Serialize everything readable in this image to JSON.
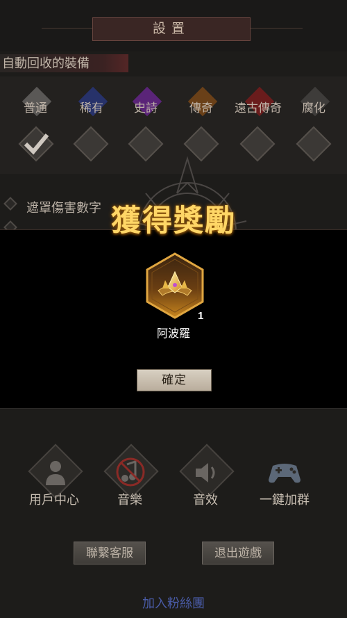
{
  "settings": {
    "title": "設置",
    "auto_recycle_header": "自動回收的裝備",
    "rarities": [
      {
        "label": "普通",
        "color": "#6b6a68"
      },
      {
        "label": "稀有",
        "color": "#2a3a7a"
      },
      {
        "label": "史詩",
        "color": "#6a2a8a"
      },
      {
        "label": "傳奇",
        "color": "#7a4a1a"
      },
      {
        "label": "遠古傳奇",
        "color": "#7a1a1a"
      },
      {
        "label": "腐化",
        "color": "#4a4846"
      }
    ],
    "checks": [
      true,
      false,
      false,
      false,
      false,
      false
    ],
    "options": [
      {
        "label": "遮罩傷害數字"
      },
      {
        "label": ""
      }
    ]
  },
  "reward": {
    "title": "獲得獎勵",
    "item_name": "阿波羅",
    "item_qty": "1",
    "item_icon": "crown-icon",
    "confirm_label": "確定"
  },
  "menu": {
    "items": [
      {
        "label": "用戶中心",
        "icon": "user-icon"
      },
      {
        "label": "音樂",
        "icon": "music-muted-icon"
      },
      {
        "label": "音效",
        "icon": "speaker-icon"
      },
      {
        "label": "一鍵加群",
        "icon": "gamepad-icon"
      }
    ],
    "support_label": "聯繫客服",
    "exit_label": "退出遊戲",
    "fan_link": "加入粉絲團"
  }
}
